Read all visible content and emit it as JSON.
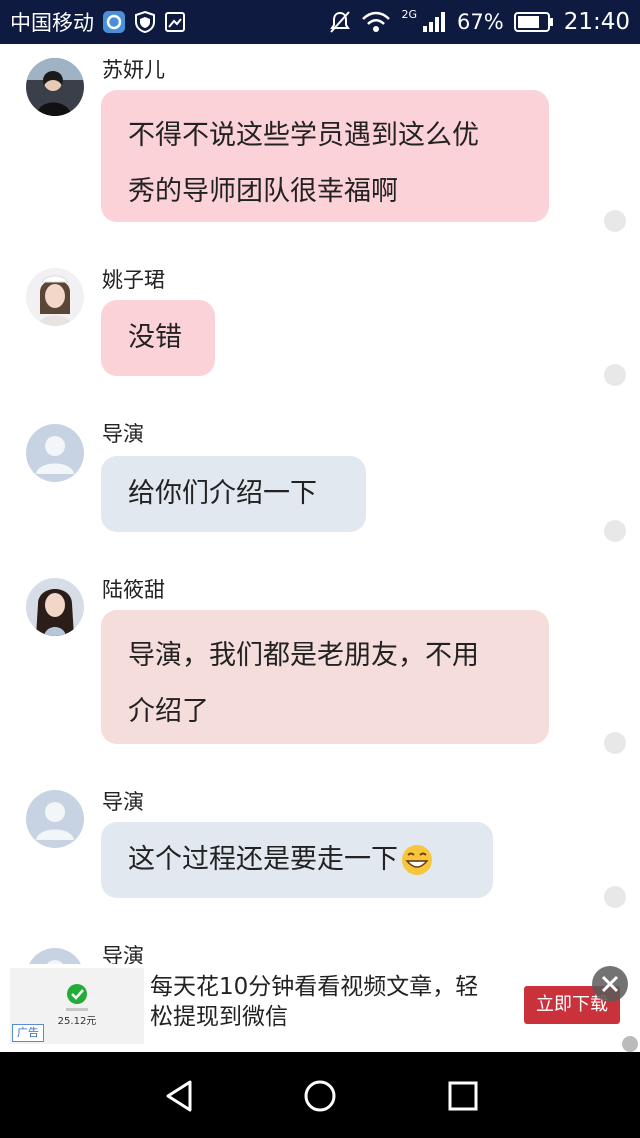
{
  "status_bar": {
    "carrier": "中国移动",
    "network": "2G",
    "battery_pct": "67%",
    "time": "21:40"
  },
  "messages": [
    {
      "sender": "苏妍儿",
      "line1": "不得不说这些学员遇到这么优",
      "line2": "秀的导师团队很幸福啊",
      "bubble_color": "#fcd2d9"
    },
    {
      "sender": "姚子珺",
      "line1": "没错",
      "bubble_color": "#fcd2d9"
    },
    {
      "sender": "导演",
      "line1": "给你们介绍一下",
      "bubble_color": "#e2e8ef"
    },
    {
      "sender": "陆筱甜",
      "line1": "导演，我们都是老朋友，不用",
      "line2": "介绍了",
      "bubble_color": "#f4dddb"
    },
    {
      "sender": "导演",
      "line1": "这个过程还是要走一下",
      "emoji": "grinning-emoji",
      "bubble_color": "#e2e8ef"
    },
    {
      "sender": "导演"
    }
  ],
  "ad": {
    "thumb_amount": "25.12元",
    "tag": "广告",
    "line1": "每天花10分钟看看视频文章，轻",
    "line2": "松提现到微信",
    "cta": "立即下载",
    "cta_color": "#c9323a"
  },
  "nav": {
    "icons": [
      "back-icon",
      "home-icon",
      "recents-icon"
    ]
  }
}
